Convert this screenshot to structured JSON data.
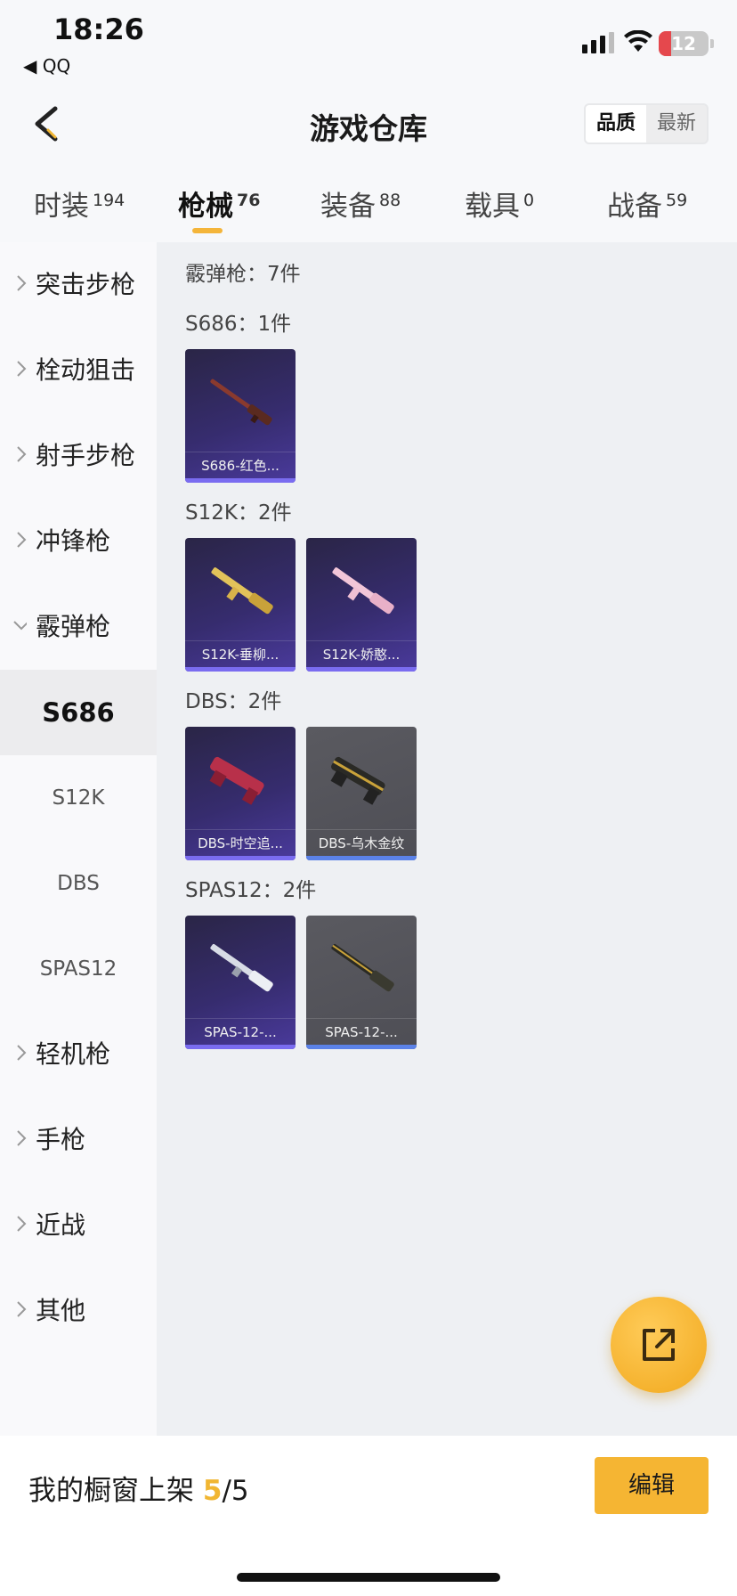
{
  "status_bar": {
    "time": "18:26",
    "back_app": "◀ QQ",
    "battery": "12"
  },
  "header": {
    "title": "游戏仓库",
    "sort_options": [
      "品质",
      "最新"
    ],
    "active_sort": "品质"
  },
  "tabs": [
    {
      "label": "时装",
      "count": "194"
    },
    {
      "label": "枪械",
      "count": "76"
    },
    {
      "label": "装备",
      "count": "88"
    },
    {
      "label": "载具",
      "count": "0"
    },
    {
      "label": "战备",
      "count": "59"
    }
  ],
  "active_tab": "枪械",
  "sidebar": {
    "categories": [
      "突击步枪",
      "栓动狙击",
      "射手步枪",
      "冲锋枪",
      "霰弹枪",
      "轻机枪",
      "手枪",
      "近战",
      "其他"
    ],
    "expanded": "霰弹枪",
    "subitems": [
      "S686",
      "S12K",
      "DBS",
      "SPAS12"
    ],
    "active_subitem": "S686"
  },
  "content": {
    "summary": "霰弹枪：7件",
    "groups": [
      {
        "title": "S686：1件",
        "items": [
          {
            "name": "S686-红色..."
          }
        ]
      },
      {
        "title": "S12K：2件",
        "items": [
          {
            "name": "S12K-垂柳..."
          },
          {
            "name": "S12K-娇憨..."
          }
        ]
      },
      {
        "title": "DBS：2件",
        "items": [
          {
            "name": "DBS-时空追..."
          },
          {
            "name": "DBS-乌木金纹"
          }
        ]
      },
      {
        "title": "SPAS12：2件",
        "items": [
          {
            "name": "SPAS-12-..."
          },
          {
            "name": "SPAS-12-..."
          }
        ]
      }
    ]
  },
  "footer": {
    "label_prefix": "我的橱窗上架 ",
    "shelf_count": "5",
    "shelf_total": "/5",
    "edit_label": "编辑"
  },
  "icons": {
    "back": "chevron-left-icon",
    "fab": "share-external-icon"
  },
  "colors": {
    "accent": "#f5b533",
    "card_purple": "#362c6e",
    "card_grey": "#4e4e55",
    "rarity_purple": "#7a6cf0",
    "rarity_blue": "#5b82e8"
  }
}
